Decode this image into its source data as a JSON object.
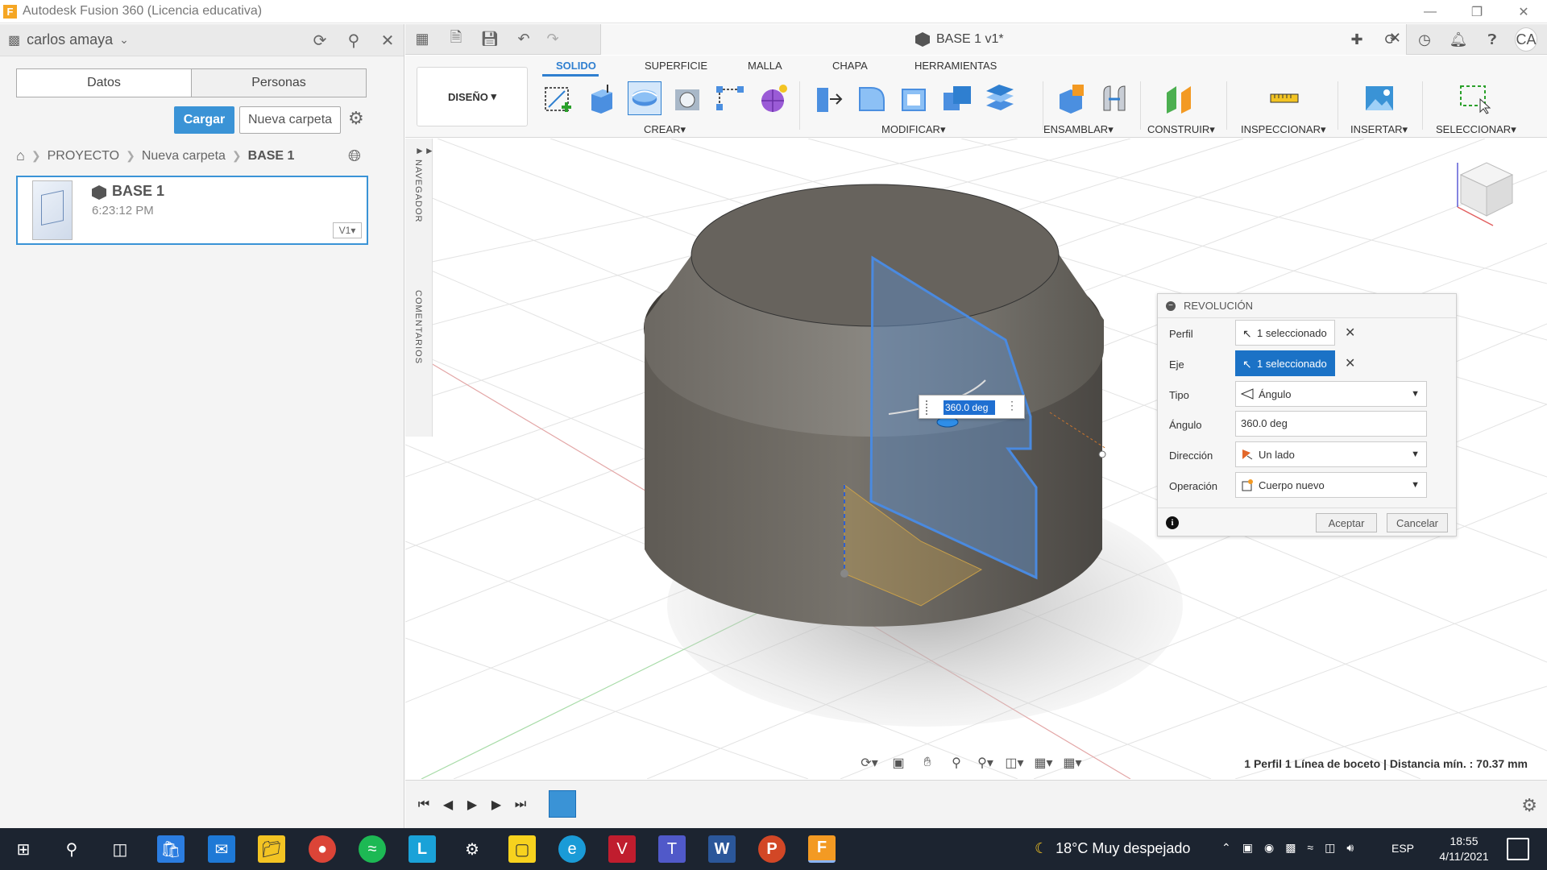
{
  "window": {
    "title": "Autodesk Fusion 360 (Licencia educativa)",
    "logo_letter": "F"
  },
  "data_panel": {
    "user": "carlos amaya",
    "tabs": [
      "Datos",
      "Personas"
    ],
    "upload_label": "Cargar",
    "new_folder_label": "Nueva carpeta",
    "breadcrumb": [
      "PROYECTO",
      "Nueva carpeta",
      "BASE 1"
    ],
    "file": {
      "name": "BASE 1",
      "time": "6:23:12 PM",
      "version": "V1"
    }
  },
  "document": {
    "title": "BASE 1 v1*",
    "user_initials": "CA"
  },
  "ribbon": {
    "workspace": "DISEÑO",
    "tabs": [
      "SOLIDO",
      "SUPERFICIE",
      "MALLA",
      "CHAPA",
      "HERRAMIENTAS"
    ],
    "groups": [
      "CREAR",
      "MODIFICAR",
      "ENSAMBLAR",
      "CONSTRUIR",
      "INSPECCIONAR",
      "INSERTAR",
      "SELECCIONAR"
    ]
  },
  "side_panels": {
    "navigator": "NAVEGADOR",
    "comments": "COMENTARIOS"
  },
  "revolve_dialog": {
    "title": "REVOLUCIÓN",
    "rows": {
      "profile": {
        "label": "Perfil",
        "value": "1 seleccionado"
      },
      "axis": {
        "label": "Eje",
        "value": "1 seleccionado"
      },
      "type": {
        "label": "Tipo",
        "value": "Ángulo"
      },
      "angle": {
        "label": "Ángulo",
        "value": "360.0 deg"
      },
      "direction": {
        "label": "Dirección",
        "value": "Un lado"
      },
      "operation": {
        "label": "Operación",
        "value": "Cuerpo nuevo"
      }
    },
    "ok_label": "Aceptar",
    "cancel_label": "Cancelar"
  },
  "canvas": {
    "angle_input": "360.0 deg",
    "status": "1 Perfil 1 Línea de boceto | Distancia mín. : 70.37 mm"
  },
  "taskbar": {
    "weather": "18°C  Muy despejado",
    "language": "ESP",
    "time": "18:55",
    "date": "4/11/2021"
  },
  "colors": {
    "accent": "#3a93d6",
    "selected": "#1b72c6",
    "body": "#6e6a63",
    "taskbar": "#1c2430"
  }
}
